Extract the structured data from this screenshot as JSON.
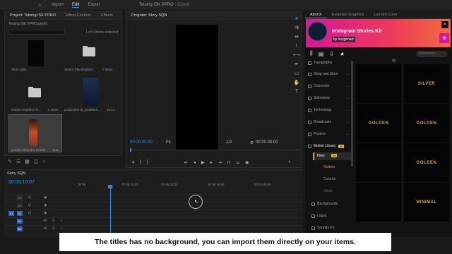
{
  "topbar": {
    "home_icon": "home-icon",
    "workspaces": [
      "Import",
      "Edit",
      "Export"
    ],
    "doc_title": "Tetsing ISK PPRO",
    "edited": "- Edited"
  },
  "project": {
    "tabs": [
      "Project: Tetsing ISK PPRO",
      "Effect Controls",
      "Effects"
    ],
    "file": "Tetsing ISK PPRO.prproj",
    "count": "1 of 5 items selected",
    "items": [
      {
        "label": "Story SQN",
        "meta": ""
      },
      {
        "label": "AtomX Placeholders",
        "meta": "0 items"
      },
      {
        "label": "Motion Graphics Te...",
        "meta": "5 items"
      },
      {
        "label": "production ID_5198954...",
        "meta": "15:14"
      },
      {
        "label": "pexels-cottonbro-57409...",
        "meta": "6:20"
      }
    ]
  },
  "monitor": {
    "tab": "Program: Story SQN",
    "tc_left": "00:00:00:00",
    "fit": "Fit",
    "ratio": "1/2",
    "tc_right": "00:00:00:00"
  },
  "extension": {
    "tabs": [
      "AtomX",
      "Essential Graphics",
      "Lumetri Color"
    ],
    "banner_title": "Instagram Stories Kit",
    "banner_by": "by oxygenart",
    "find_placeholder": "Find items...",
    "categories": [
      {
        "label": "Typography",
        "badge": ""
      },
      {
        "label": "Shop and Store",
        "badge": ""
      },
      {
        "label": "Corporate",
        "badge": ""
      },
      {
        "label": "Slideshow",
        "badge": ""
      },
      {
        "label": "Technology",
        "badge": ""
      },
      {
        "label": "Broadcasts",
        "badge": ""
      },
      {
        "label": "Posters",
        "badge": ""
      },
      {
        "label": "Motion Library",
        "badge": "56"
      },
      {
        "label": "Backgrounds",
        "badge": ""
      },
      {
        "label": "Logos",
        "badge": ""
      },
      {
        "label": "Sounds FX",
        "badge": ""
      }
    ],
    "titles": {
      "label": "Titles",
      "badge": "56"
    },
    "subitems": [
      "Golden",
      "Colorful",
      "Glitch"
    ],
    "grid_titles": [
      "",
      "SILVER",
      "GOLDEN",
      "GOLDEN",
      "",
      "GOLDEN",
      "",
      "",
      "",
      "MINIMAL"
    ]
  },
  "timeline": {
    "tab": "Story SQN",
    "timecode": "00:00:10:07",
    "ruler": [
      "00:00",
      "00:00:15:00",
      "00:00:30:00",
      "00:00:45:00",
      "00:01:00:00"
    ],
    "video_tracks": [
      "V3",
      "V2",
      "V1"
    ],
    "audio_tracks": [
      "A1",
      "A2"
    ]
  },
  "caption": "The titles has no background, you can import them directly on your items."
}
